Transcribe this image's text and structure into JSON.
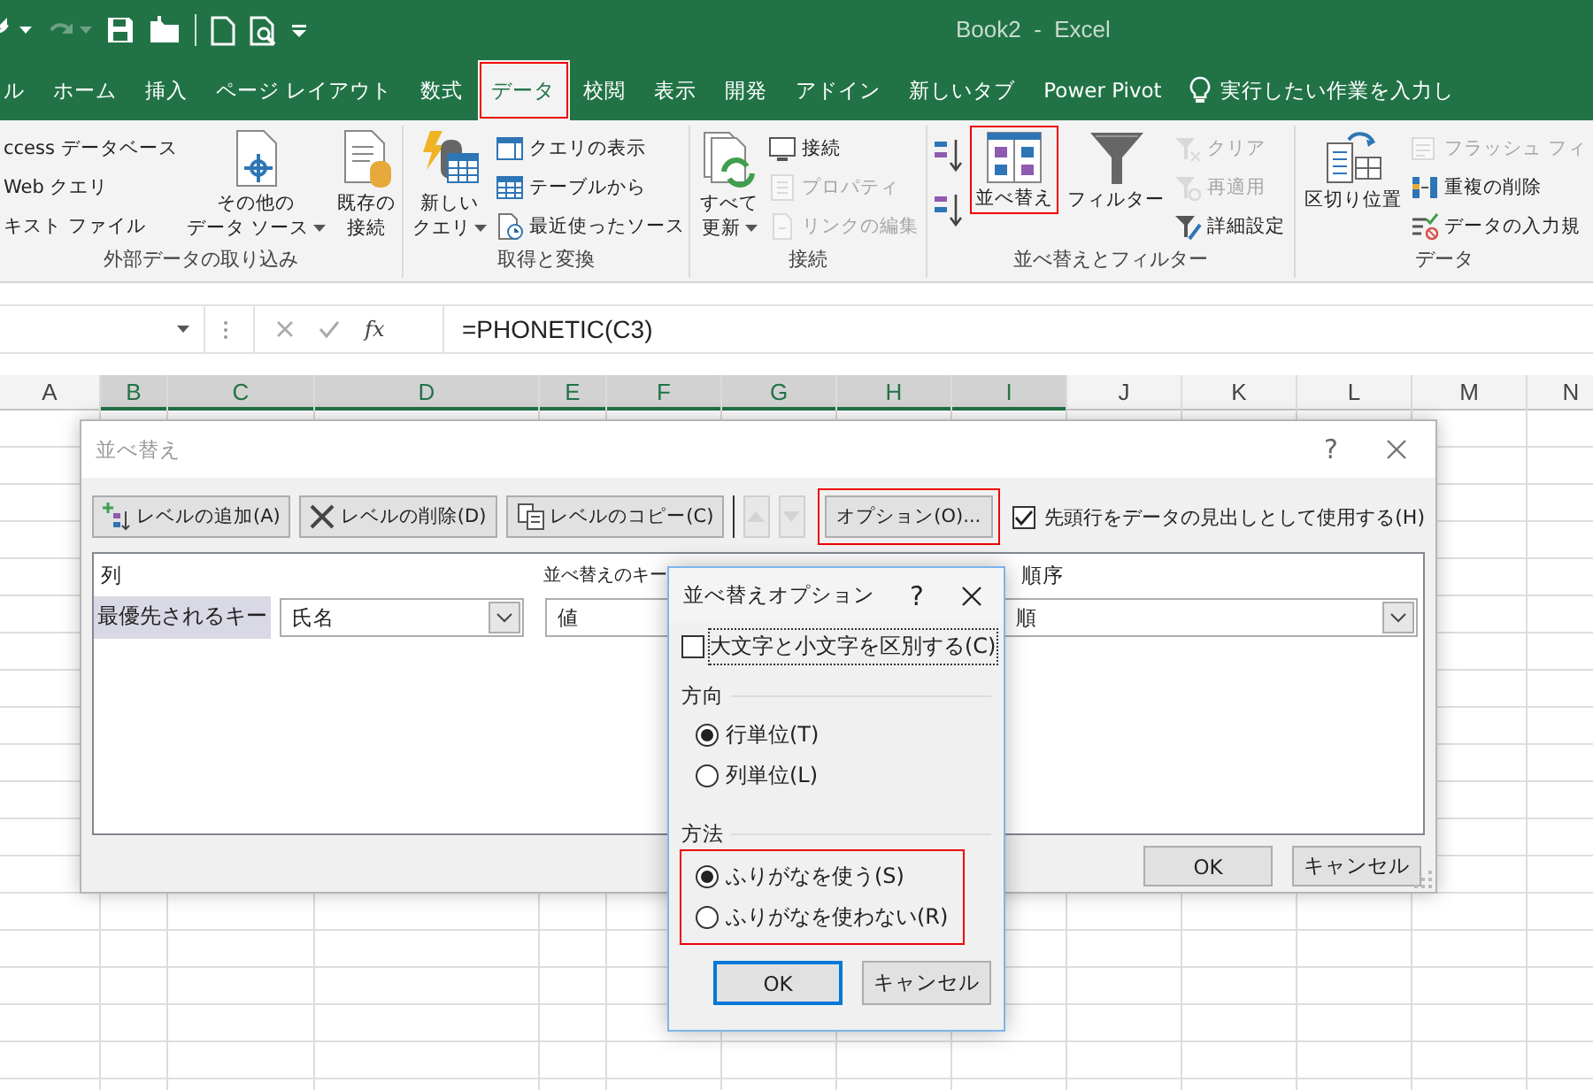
{
  "window": {
    "title": "Book2  -  Excel"
  },
  "tabs": [
    {
      "label": "ル",
      "selected": false,
      "highlighted": false
    },
    {
      "label": "ホーム",
      "selected": false,
      "highlighted": false
    },
    {
      "label": "挿入",
      "selected": false,
      "highlighted": false
    },
    {
      "label": "ページ レイアウト",
      "selected": false,
      "highlighted": false
    },
    {
      "label": "数式",
      "selected": false,
      "highlighted": false
    },
    {
      "label": "データ",
      "selected": true,
      "highlighted": true
    },
    {
      "label": "校閲",
      "selected": false,
      "highlighted": false
    },
    {
      "label": "表示",
      "selected": false,
      "highlighted": false
    },
    {
      "label": "開発",
      "selected": false,
      "highlighted": false
    },
    {
      "label": "アドイン",
      "selected": false,
      "highlighted": false
    },
    {
      "label": "新しいタブ",
      "selected": false,
      "highlighted": false
    },
    {
      "label": "Power Pivot",
      "selected": false,
      "highlighted": false
    }
  ],
  "tell_me": {
    "label": "実行したい作業を入力し"
  },
  "ribbon": {
    "groups": [
      {
        "label": "外部データの取り込み",
        "items": [
          {
            "kind": "small",
            "label": "ccess データベース",
            "disabled": false
          },
          {
            "kind": "small",
            "label": "Web クエリ",
            "disabled": false
          },
          {
            "kind": "small",
            "label": "キスト ファイル",
            "disabled": false
          },
          {
            "kind": "large",
            "lines": [
              "その他の",
              "データ ソース"
            ],
            "dropdown": true,
            "disabled": false
          },
          {
            "kind": "large",
            "lines": [
              "既存の",
              "接続"
            ],
            "dropdown": false,
            "disabled": false
          }
        ]
      },
      {
        "label": "取得と変換",
        "items": [
          {
            "kind": "large",
            "lines": [
              "新しい",
              "クエリ"
            ],
            "dropdown": true,
            "disabled": false
          },
          {
            "kind": "small",
            "label": "クエリの表示",
            "disabled": false
          },
          {
            "kind": "small",
            "label": "テーブルから",
            "disabled": false
          },
          {
            "kind": "small",
            "label": "最近使ったソース",
            "disabled": false
          }
        ]
      },
      {
        "label": "接続",
        "items": [
          {
            "kind": "large",
            "lines": [
              "すべて",
              "更新"
            ],
            "dropdown": true,
            "disabled": false
          },
          {
            "kind": "small",
            "label": "接続",
            "disabled": false
          },
          {
            "kind": "small",
            "label": "プロパティ",
            "disabled": true
          },
          {
            "kind": "small",
            "label": "リンクの編集",
            "disabled": true
          }
        ]
      },
      {
        "label": "並べ替えとフィルター",
        "items": [
          {
            "kind": "icon",
            "disabled": false
          },
          {
            "kind": "icon",
            "disabled": false
          },
          {
            "kind": "large",
            "lines": [
              "並べ替え"
            ],
            "dropdown": false,
            "disabled": false,
            "highlighted": true
          },
          {
            "kind": "large",
            "lines": [
              "フィルター"
            ],
            "dropdown": false,
            "disabled": false,
            "highlighted": false
          },
          {
            "kind": "small",
            "label": "クリア",
            "disabled": true
          },
          {
            "kind": "small",
            "label": "再適用",
            "disabled": true
          },
          {
            "kind": "small",
            "label": "詳細設定",
            "disabled": false
          }
        ]
      },
      {
        "label": "データ",
        "items": [
          {
            "kind": "large",
            "lines": [
              "区切り位置"
            ],
            "dropdown": false,
            "disabled": false
          },
          {
            "kind": "small",
            "label": "フラッシュ フィ",
            "disabled": true
          },
          {
            "kind": "small",
            "label": "重複の削除",
            "disabled": false
          },
          {
            "kind": "small",
            "label": "データの入力規",
            "disabled": false
          }
        ]
      }
    ]
  },
  "formula_bar": {
    "function_label": "fx",
    "formula": "=PHONETIC(C3)"
  },
  "columns": [
    {
      "label": "A",
      "selected": false
    },
    {
      "label": "B",
      "selected": true
    },
    {
      "label": "C",
      "selected": true
    },
    {
      "label": "D",
      "selected": true
    },
    {
      "label": "E",
      "selected": true
    },
    {
      "label": "F",
      "selected": true
    },
    {
      "label": "G",
      "selected": true
    },
    {
      "label": "H",
      "selected": true
    },
    {
      "label": "I",
      "selected": true
    },
    {
      "label": "J",
      "selected": false
    },
    {
      "label": "K",
      "selected": false
    },
    {
      "label": "L",
      "selected": false
    },
    {
      "label": "M",
      "selected": false
    },
    {
      "label": "N",
      "selected": false
    }
  ],
  "sort_dialog": {
    "title": "並べ替え",
    "help": "?",
    "toolbar": [
      {
        "kind": "add",
        "label": "レベルの追加(A)",
        "disabled": false,
        "highlighted": false
      },
      {
        "kind": "delete",
        "label": "レベルの削除(D)",
        "disabled": false,
        "highlighted": false
      },
      {
        "kind": "copy",
        "label": "レベルのコピー(C)",
        "disabled": false,
        "highlighted": false
      },
      {
        "kind": "up",
        "disabled": true,
        "highlighted": false
      },
      {
        "kind": "down",
        "disabled": true,
        "highlighted": false
      },
      {
        "kind": "text",
        "label": "オプション(O)...",
        "disabled": false,
        "highlighted": true
      }
    ],
    "header_checkbox": {
      "label": "先頭行をデータの見出しとして使用する(H)",
      "checked": true
    },
    "columns": [
      "列",
      "並べ替えのキー",
      "順序"
    ],
    "levels": [
      {
        "label": "最優先されるキー",
        "column": "氏名",
        "key": "値",
        "order": "順",
        "selected": true
      }
    ],
    "buttons": [
      "OK",
      "キャンセル"
    ]
  },
  "options_dialog": {
    "title": "並べ替えオプション",
    "help": "?",
    "case_sensitive": {
      "label": "大文字と小文字を区別する(C)",
      "checked": false
    },
    "sections": [
      {
        "title": "方向",
        "highlighted": false,
        "options": [
          {
            "label": "行単位(T)",
            "selected": true
          },
          {
            "label": "列単位(L)",
            "selected": false
          }
        ]
      },
      {
        "title": "方法",
        "highlighted": true,
        "options": [
          {
            "label": "ふりがなを使う(S)",
            "selected": true
          },
          {
            "label": "ふりがなを使わない(R)",
            "selected": false
          }
        ]
      }
    ],
    "buttons": [
      {
        "label": "OK",
        "default": true
      },
      {
        "label": "キャンセル",
        "default": false
      }
    ]
  }
}
